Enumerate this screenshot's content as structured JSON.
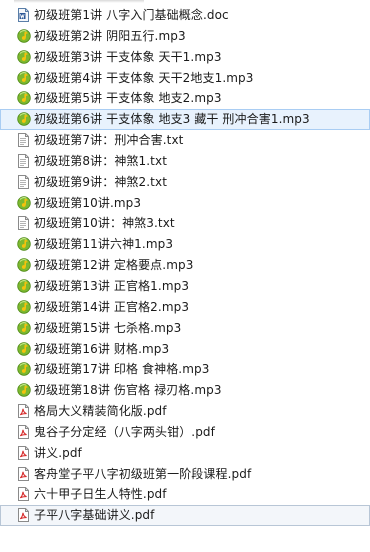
{
  "files": [
    {
      "name": "初级班第1讲 八字入门基础概念.doc",
      "type": "doc",
      "icon": "word-doc-icon"
    },
    {
      "name": "初级班第2讲 阴阳五行.mp3",
      "type": "mp3",
      "icon": "audio-file-icon"
    },
    {
      "name": "初级班第3讲 干支体象 天干1.mp3",
      "type": "mp3",
      "icon": "audio-file-icon"
    },
    {
      "name": "初级班第4讲 干支体象 天干2地支1.mp3",
      "type": "mp3",
      "icon": "audio-file-icon"
    },
    {
      "name": "初级班第5讲 干支体象 地支2.mp3",
      "type": "mp3",
      "icon": "audio-file-icon"
    },
    {
      "name": "初级班第6讲 干支体象 地支3 藏干 刑冲合害1.mp3",
      "type": "mp3",
      "icon": "audio-file-icon",
      "selected": true
    },
    {
      "name": "初级班第7讲：刑冲合害.txt",
      "type": "txt",
      "icon": "text-file-icon"
    },
    {
      "name": "初级班第8讲：神煞1.txt",
      "type": "txt",
      "icon": "text-file-icon"
    },
    {
      "name": "初级班第9讲：神煞2.txt",
      "type": "txt",
      "icon": "text-file-icon"
    },
    {
      "name": "初级班第10讲.mp3",
      "type": "mp3",
      "icon": "audio-file-icon"
    },
    {
      "name": "初级班第10讲：神煞3.txt",
      "type": "txt",
      "icon": "text-file-icon"
    },
    {
      "name": "初级班第11讲六神1.mp3",
      "type": "mp3",
      "icon": "audio-file-icon"
    },
    {
      "name": "初级班第12讲 定格要点.mp3",
      "type": "mp3",
      "icon": "audio-file-icon"
    },
    {
      "name": "初级班第13讲 正官格1.mp3",
      "type": "mp3",
      "icon": "audio-file-icon"
    },
    {
      "name": "初级班第14讲 正官格2.mp3",
      "type": "mp3",
      "icon": "audio-file-icon"
    },
    {
      "name": "初级班第15讲 七杀格.mp3",
      "type": "mp3",
      "icon": "audio-file-icon"
    },
    {
      "name": "初级班第16讲 财格.mp3",
      "type": "mp3",
      "icon": "audio-file-icon"
    },
    {
      "name": "初级班第17讲 印格 食神格.mp3",
      "type": "mp3",
      "icon": "audio-file-icon"
    },
    {
      "name": "初级班第18讲 伤官格 禄刃格.mp3",
      "type": "mp3",
      "icon": "audio-file-icon"
    },
    {
      "name": "格局大义精装简化版.pdf",
      "type": "pdf",
      "icon": "pdf-file-icon"
    },
    {
      "name": "鬼谷子分定经（八字两头钳）.pdf",
      "type": "pdf",
      "icon": "pdf-file-icon"
    },
    {
      "name": "讲义.pdf",
      "type": "pdf",
      "icon": "pdf-file-icon"
    },
    {
      "name": "客舟堂子平八字初级班第一阶段课程.pdf",
      "type": "pdf",
      "icon": "pdf-file-icon"
    },
    {
      "name": "六十甲子日生人特性.pdf",
      "type": "pdf",
      "icon": "pdf-file-icon"
    },
    {
      "name": "子平八字基础讲义.pdf",
      "type": "pdf",
      "icon": "pdf-file-icon",
      "last_selected": true
    }
  ]
}
